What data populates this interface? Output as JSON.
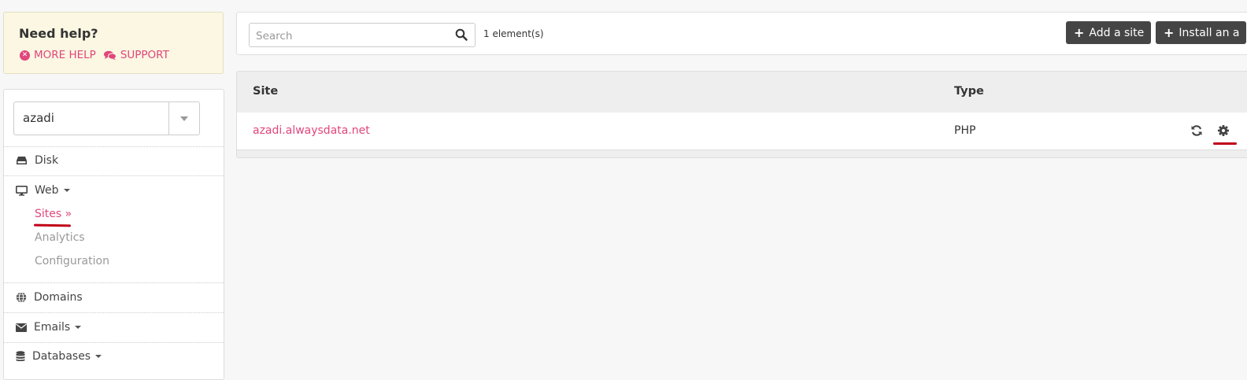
{
  "help": {
    "title": "Need help?",
    "more_help": "MORE HELP",
    "support": "SUPPORT"
  },
  "account": {
    "selected": "azadi"
  },
  "sidebar": {
    "disk": "Disk",
    "web": "Web",
    "web_sub": {
      "sites": "Sites »",
      "analytics": "Analytics",
      "configuration": "Configuration"
    },
    "domains": "Domains",
    "emails": "Emails",
    "databases": "Databases"
  },
  "toolbar": {
    "search_placeholder": "Search",
    "count": "1 element(s)",
    "add_site": "Add a site",
    "install_app": "Install an a"
  },
  "table": {
    "columns": {
      "site": "Site",
      "type": "Type"
    },
    "rows": [
      {
        "site": "azadi.alwaysdata.net",
        "type": "PHP"
      }
    ]
  },
  "colors": {
    "accent": "#e1467c",
    "help_bg": "#fbf7e2",
    "button_bg": "#454545",
    "annotation": "#c00018"
  }
}
